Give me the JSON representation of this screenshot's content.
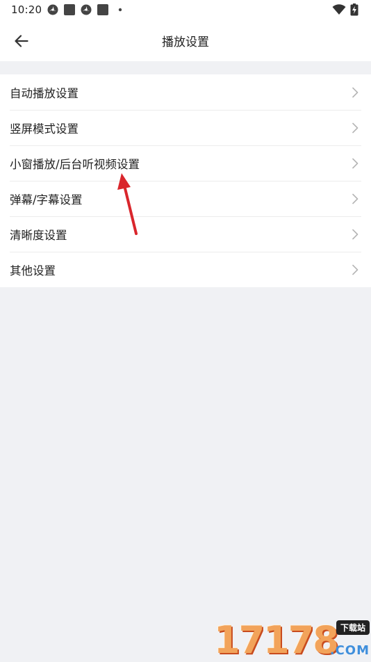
{
  "status_bar": {
    "time": "10:20",
    "left_icons": [
      "vpn-fan-icon",
      "app-square-icon",
      "vpn-fan-icon",
      "app-square-icon",
      "dot-icon"
    ],
    "right_icons": [
      "wifi-icon",
      "battery-charging-icon"
    ]
  },
  "header": {
    "back_icon": "arrow-left-icon",
    "title": "播放设置"
  },
  "settings": {
    "items": [
      {
        "label": "自动播放设置"
      },
      {
        "label": "竖屏模式设置"
      },
      {
        "label": "小窗播放/后台听视频设置"
      },
      {
        "label": "弹幕/字幕设置"
      },
      {
        "label": "清晰度设置"
      },
      {
        "label": "其他设置"
      }
    ]
  },
  "annotation": {
    "icon": "red-arrow-icon",
    "color": "#d9262c"
  },
  "watermark": {
    "number": "17178",
    "badge": "下载站",
    "domain": ".COM"
  },
  "colors": {
    "background": "#f0f1f4",
    "surface": "#ffffff",
    "text": "#222222",
    "chevron": "#b5b5b5"
  }
}
